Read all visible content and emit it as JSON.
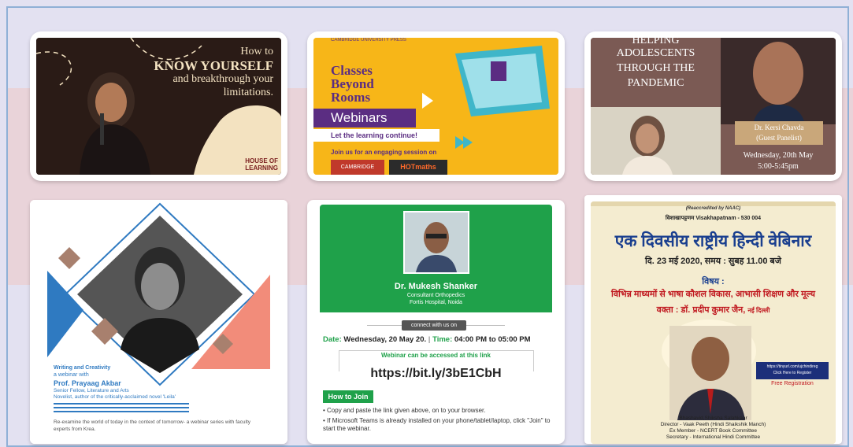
{
  "cards": [
    {
      "lines": [
        "How to",
        "KNOW YOURSELF",
        "and breakthrough your",
        "limitations."
      ],
      "brand": "HOUSE OF LEARNING",
      "colors": {
        "bg": "#2b1c17",
        "accent": "#f4e3c2"
      }
    },
    {
      "publisher": "CAMBRIDGE UNIVERSITY PRESS",
      "title_lines": [
        "Classes",
        "Beyond",
        "Rooms"
      ],
      "webinars": "Webinars",
      "ribbon": "Let the learning continue!",
      "join": "Join us for an engaging session on",
      "logo_cambridge": "CAMBRIDGE",
      "logo_hotmaths": "HOTmaths",
      "colors": {
        "bg": "#f7b618",
        "purple": "#5b2d82"
      }
    },
    {
      "title_lines": [
        "HELPING",
        "ADOLESCENTS",
        "THROUGH THE",
        "PANDEMIC"
      ],
      "panelist_name": "Dr. Kersi Chavda",
      "panelist_role": "(Guest Panelist)",
      "date": "Wednesday, 20th May",
      "time": "5:00-5:45pm",
      "colors": {
        "bg": "#7b5a54"
      }
    },
    {
      "heading": "Writing and Creativity",
      "subheading": "a webinar with",
      "speaker": "Prof. Prayaag Akbar",
      "role1": "Senior Fellow, Literature and Arts",
      "role2": "Novelist, author of the critically-acclaimed novel 'Leila'",
      "description": "Re-examine the world of today in the context of tomorrow- a webinar series with faculty experts from Krea.",
      "colors": {
        "blue": "#2f7ac1",
        "salmon": "#f28c7a",
        "brown": "#a8806e"
      }
    },
    {
      "doctor": "Dr. Mukesh Shanker",
      "specialty": "Consultant Orthopedics",
      "hospital": "Fortis Hospital, Noida",
      "connect": "connect with us on",
      "date_label": "Date:",
      "date_value": "Wednesday, 20 May 20.",
      "time_label": "Time:",
      "time_value": "04:00 PM to 05:00 PM",
      "access": "Webinar can be accessed at this link",
      "link": "https://bit.ly/3bE1CbH",
      "how_to_join": "How to Join",
      "step1": "• Copy and paste the link given above, on to your browser.",
      "step2": "• If Microsoft Teams is already installed on your phone/tablet/laptop, click \"Join\" to start the webinar.",
      "colors": {
        "green": "#1fa14a"
      }
    },
    {
      "accred": "(Reaccredited by NAAC)",
      "city": "विशाखापट्टणम Visakhapatnam - 530 004",
      "title": "एक दिवसीय राष्ट्रीय हिन्दी वेबिनार",
      "date_line": "दि. 23 मई 2020,  समय : सुबह 11.00 बजे",
      "topic_label": "विषय :",
      "topic": "विभिन्न माध्यमों से भाषा कौशल विकास, आभासी शिक्षण और मूल्य",
      "speaker_line": "वक्ता : डॉ. प्रदीप कुमार जैन,",
      "speaker_city": "नई दिल्ली",
      "reg_link": "https://tinyurl.com/ujchindireg",
      "reg_click": "Click Here to Register",
      "free_reg": "Free Registration",
      "footer1": "Bhashavid,Shiksha Salahkaar",
      "footer2": "Director - Vaak Peeth (Hindi Shaikshik Manch)",
      "footer3": "Ex Member - NCERT Book Committee",
      "footer4": "Secretary - International Hindi Committee",
      "colors": {
        "bg": "#f4ecd0",
        "title": "#1a3f8f",
        "topic": "#c0181f"
      }
    }
  ]
}
